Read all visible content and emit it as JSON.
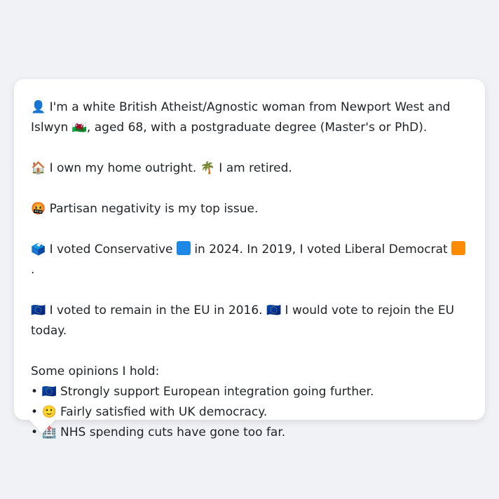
{
  "profile": {
    "intro": {
      "icon": "👤",
      "text_before_flag": "I'm a white British Atheist/Agnostic woman from Newport West and Islwyn",
      "flag": "🏴󠁧󠁢󠁷󠁬󠁳󠁿",
      "text_after_flag": ", aged 68, with a postgraduate degree (Master's or PhD)."
    },
    "housing": {
      "home_icon": "🏠",
      "home_text": "I own my home outright.",
      "work_icon": "🌴",
      "work_text": "I am retired."
    },
    "issue": {
      "icon": "🤬",
      "text": "Partisan negativity is my top issue."
    },
    "vote": {
      "icon": "🗳️",
      "text_part1": "I voted Conservative",
      "party_2024_color": "#1e88e5",
      "text_part2": "in 2024. In 2019, I voted Liberal Democrat",
      "party_2019_color": "#fb8c00",
      "text_part3": "."
    },
    "eu": {
      "icon1": "🇪🇺",
      "text1": "I voted to remain in the EU in 2016.",
      "icon2": "🇪🇺",
      "text2": "I would vote to rejoin the EU today."
    },
    "opinions": {
      "heading": "Some opinions I hold:",
      "bullet": "•",
      "items": [
        {
          "icon": "🇪🇺",
          "text": "Strongly support European integration going further."
        },
        {
          "icon": "🙂",
          "text": "Fairly satisfied with UK democracy."
        },
        {
          "icon": "🏥",
          "text": "NHS spending cuts have gone too far."
        }
      ]
    }
  }
}
